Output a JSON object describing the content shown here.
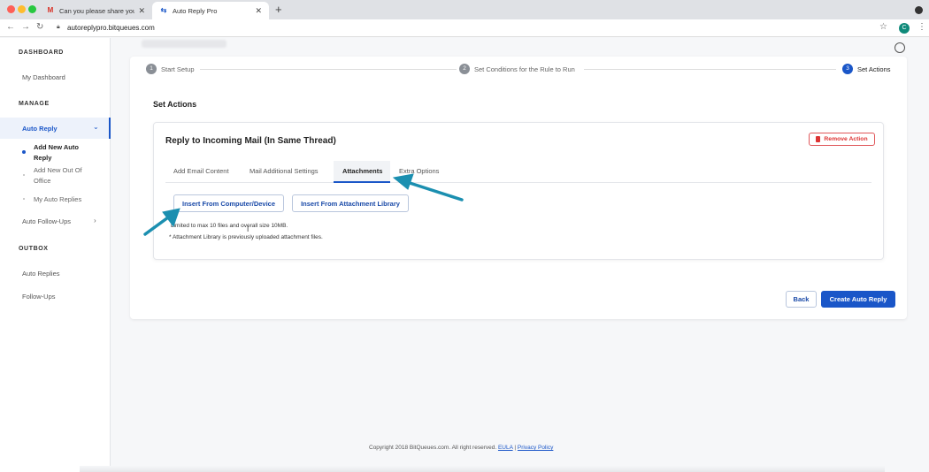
{
  "browser": {
    "tabs": [
      {
        "title": "Can you please share your me",
        "icon": "gmail-icon"
      },
      {
        "title": "Auto Reply Pro",
        "icon": "auto-reply-pro-icon"
      }
    ],
    "url": "autoreplypro.bitqueues.com",
    "profile_initial": "C"
  },
  "sidebar": {
    "dashboard_heading": "DASHBOARD",
    "my_dashboard": "My Dashboard",
    "manage_heading": "MANAGE",
    "auto_reply": "Auto Reply",
    "sub_items": [
      "Add New Auto Reply",
      "Add New Out Of Office",
      "My Auto Replies"
    ],
    "auto_followups": "Auto Follow-Ups",
    "outbox_heading": "OUTBOX",
    "outbox_auto_replies": "Auto Replies",
    "outbox_followups": "Follow-Ups"
  },
  "stepper": {
    "steps": [
      {
        "num": "1",
        "label": "Start Setup"
      },
      {
        "num": "2",
        "label": "Set Conditions for the Rule to Run"
      },
      {
        "num": "3",
        "label": "Set Actions"
      }
    ],
    "active_step": 3
  },
  "section_title": "Set Actions",
  "action": {
    "title": "Reply to Incoming Mail (In Same Thread)",
    "remove_label": "Remove Action",
    "tabs": [
      "Add Email Content",
      "Mail Additional Settings",
      "Attachments",
      "Extra Options"
    ],
    "active_tab": "Attachments",
    "insert_computer": "Insert From Computer/Device",
    "insert_library": "Insert From Attachment Library",
    "note1": "Limited to max 10 files and overall size 10MB.",
    "note2": "* Attachment Library is previously uploaded attachment files."
  },
  "buttons": {
    "back": "Back",
    "create": "Create Auto Reply"
  },
  "footer": {
    "copyright": "Copyright 2018 BitQueues.com. All right reserved.",
    "eula": "EULA",
    "separator": "|",
    "privacy": "Privacy Policy"
  },
  "colors": {
    "accent": "#1a56c8",
    "danger": "#d33333",
    "annotation_arrow": "#1b8fb0"
  }
}
